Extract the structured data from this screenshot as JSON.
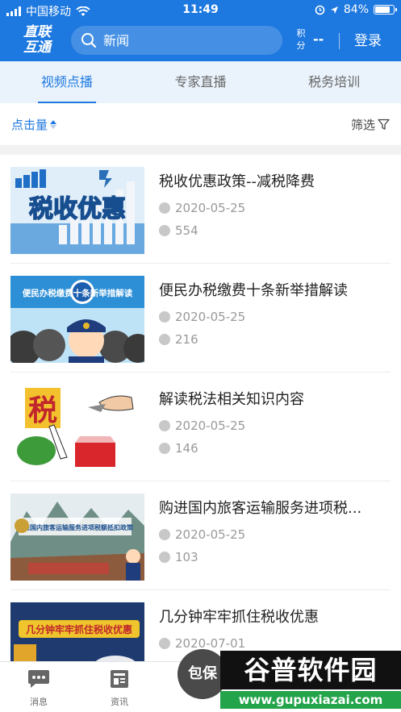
{
  "status_bar": {
    "carrier": "中国移动",
    "time": "11:49",
    "battery_text": "84%",
    "battery_level": 0.84
  },
  "header": {
    "logo_line1": "直联",
    "logo_line2": "互通",
    "search_placeholder": "新闻",
    "points_label": "积分",
    "points_value": "--",
    "login_label": "登录"
  },
  "tabs": [
    {
      "label": "视频点播",
      "active": true
    },
    {
      "label": "专家直播",
      "active": false
    },
    {
      "label": "税务培训",
      "active": false
    }
  ],
  "sortbar": {
    "sort_label": "点击量",
    "filter_label": "筛选"
  },
  "videos": [
    {
      "title": "税收优惠政策--减税降费",
      "date": "2020-05-25",
      "views": "554",
      "thumb_text": "税收优惠"
    },
    {
      "title": "便民办税缴费十条新举措解读",
      "date": "2020-05-25",
      "views": "216",
      "thumb_text": "便民办税缴费十条新举措解读"
    },
    {
      "title": "解读税法相关知识内容",
      "date": "2020-05-25",
      "views": "146",
      "thumb_text": "税"
    },
    {
      "title": "购进国内旅客运输服务进项税...",
      "date": "2020-05-25",
      "views": "103",
      "thumb_text": "购进国内旅客运输服务进项税额抵扣政策"
    },
    {
      "title": "几分钟牢牢抓住税收优惠",
      "date": "2020-07-01",
      "views": "",
      "thumb_text": "几分钟牢牢抓住税收优惠"
    }
  ],
  "bottom_nav": {
    "messages": "消息",
    "news": "资讯",
    "fab": "包保"
  },
  "watermark": {
    "title": "谷普软件园",
    "url": "www.gupuxiazai.com"
  },
  "colors": {
    "brand": "#1d78e0",
    "tab_bg": "#eaf3fc",
    "meta_gray": "#999999"
  }
}
